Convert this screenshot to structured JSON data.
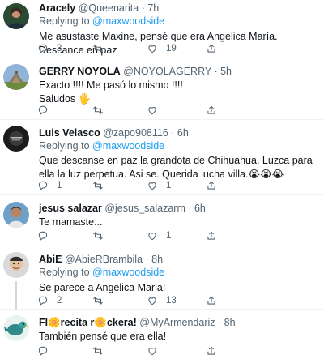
{
  "tweets": [
    {
      "name": "Aracely",
      "handle": "@Queenarita",
      "sep": " · ",
      "time": "7h",
      "replying_prefix": "Replying to ",
      "replying_handle": "@maxwoodside",
      "text": "Me asustaste Maxine, pensé que era Angelica María. Descance en paz",
      "reply_count": "3",
      "retweet_count": "",
      "like_count": "19"
    },
    {
      "name": "GERRY NOYOLA",
      "handle": "@NOYOLAGERRY",
      "sep": " · ",
      "time": "5h",
      "text_line1": "Exacto !!!! Me pasó lo mismo !!!!",
      "text_line2": "Saludos 🖐",
      "reply_count": "",
      "retweet_count": "",
      "like_count": ""
    },
    {
      "name": "Luis Velasco",
      "handle": "@zapo908116",
      "sep": " · ",
      "time": "6h",
      "replying_prefix": "Replying to ",
      "replying_handle": "@maxwoodside",
      "text": "Que descanse en paz la grandota de Chihuahua. Luzca para ella la luz perpetua. Asi se. Querida lucha villa.😭😭😭",
      "reply_count": "1",
      "retweet_count": "",
      "like_count": "1"
    },
    {
      "name": "jesus salazar",
      "handle": "@jesus_salazarm",
      "sep": " · ",
      "time": "6h",
      "text": "Te mamaste...",
      "reply_count": "",
      "retweet_count": "",
      "like_count": "1"
    },
    {
      "name": "AbiE",
      "handle": "@AbieRBrambila",
      "sep": " · ",
      "time": "8h",
      "replying_prefix": "Replying to ",
      "replying_handle": "@maxwoodside",
      "text": "Se parece a Angelica Maria!",
      "reply_count": "2",
      "retweet_count": "",
      "like_count": "13"
    },
    {
      "name": "Fl🌼recita r🌼ckera!",
      "handle": "@MyArmendariz",
      "sep": " · ",
      "time": "8h",
      "text": "También pensé que era ella!",
      "reply_count": "",
      "retweet_count": "",
      "like_count": ""
    }
  ],
  "colors": {
    "accent": "#1d9bf0",
    "secondary_text": "#536471",
    "divider": "#eff3f4"
  },
  "icons": [
    "reply-icon",
    "retweet-icon",
    "like-icon",
    "share-icon"
  ]
}
